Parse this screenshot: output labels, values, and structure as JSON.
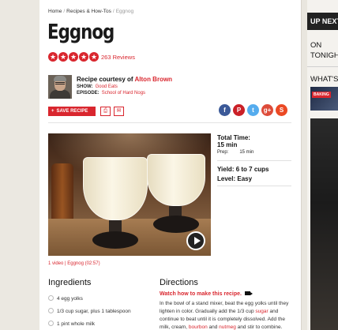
{
  "breadcrumb": {
    "home": "Home",
    "section": "Recipes & How-Tos",
    "current": "Eggnog"
  },
  "recipe": {
    "title": "Eggnog",
    "rating_stars": 5,
    "reviews_label": "263 Reviews",
    "courtesy_prefix": "Recipe courtesy of",
    "author": "Alton Brown",
    "show_label": "SHOW:",
    "show_value": "Good Eats",
    "episode_label": "EPISODE:",
    "episode_value": "School of Hard Nogs"
  },
  "actions": {
    "save_label": "SAVE RECIPE",
    "plus_glyph": "+",
    "print_glyph": "⎙",
    "email_glyph": "✉"
  },
  "social": [
    {
      "name": "facebook",
      "glyph": "f",
      "color": "#3b5998"
    },
    {
      "name": "pinterest",
      "glyph": "P",
      "color": "#cb2027"
    },
    {
      "name": "twitter",
      "glyph": "t",
      "color": "#55acee"
    },
    {
      "name": "googleplus",
      "glyph": "g+",
      "color": "#dd4b39"
    },
    {
      "name": "stumble",
      "glyph": "S",
      "color": "#eb4924"
    }
  ],
  "info": {
    "total_time_label": "Total Time:",
    "total_time_value": "15 min",
    "prep_label": "Prep:",
    "prep_value": "15 min",
    "yield_label": "Yield:",
    "yield_value": "6 to 7 cups",
    "level_label": "Level:",
    "level_value": "Easy"
  },
  "video": {
    "caption": "1 video | Eggnog (02:57)"
  },
  "ingredients": {
    "heading": "Ingredients",
    "items": [
      "4 egg yolks",
      "1/3 cup sugar, plus 1 tablespoon",
      "1 pint whole milk"
    ]
  },
  "directions": {
    "heading": "Directions",
    "watch_label": "Watch how to make this recipe.",
    "text_1": "In the bowl of a stand mixer, beat the egg yolks until they lighten in color. Gradually add the 1/3 cup ",
    "text_link_1": "sugar",
    "text_2": " and continue to beat until it is completely dissolved. Add the milk, cream, ",
    "text_link_2": "bourbon",
    "text_3": " and ",
    "text_link_3": "nutmeg",
    "text_4": " and stir to combine."
  },
  "sidebar": {
    "up_next": "UP NEXT",
    "on_tonight_1": "ON",
    "on_tonight_2": "TONIGHT",
    "whats_hot": "WHAT'S H",
    "thumb_tag": "BAKING"
  },
  "colors": {
    "accent": "#d9262e",
    "text": "#111111"
  }
}
